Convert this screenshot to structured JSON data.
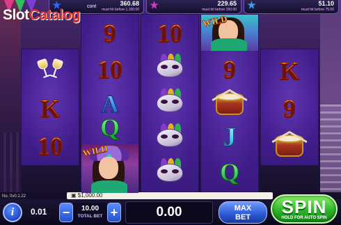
{
  "logo": {
    "part1": "Slot",
    "part2": "Catalog"
  },
  "jackpots": [
    {
      "value": "360.68",
      "must_hit": "must hit before 1,100.00",
      "star_color": "#2a6bff",
      "extra": "cont"
    },
    {
      "value": "229.65",
      "must_hit": "must hit before 250.00",
      "star_color": "#d935c9",
      "extra": ""
    },
    {
      "value": "51.10",
      "must_hit": "must hit before 75.00",
      "star_color": "#3a9ee8",
      "extra": ""
    }
  ],
  "reels": [
    {
      "symbols": [
        "champagne",
        "K",
        "10"
      ]
    },
    {
      "symbols": [
        "9",
        "10",
        "A",
        "Q",
        "wild"
      ]
    },
    {
      "symbols": [
        "10",
        "mask",
        "mask",
        "mask",
        "mask"
      ]
    },
    {
      "symbols": [
        "wild",
        "9",
        "drum",
        "J",
        "Q"
      ]
    },
    {
      "symbols": [
        "K",
        "9",
        "drum"
      ]
    }
  ],
  "wild_text": "WILD",
  "balance": "$1,000.00",
  "build_info": "No. 0v0.1.22",
  "bet_line": "0.01",
  "total_bet": {
    "value": "10.00",
    "label": "TOTAL BET"
  },
  "win": "0.00",
  "buttons": {
    "info": "i",
    "minus": "−",
    "plus": "+",
    "max_bet_line1": "MAX",
    "max_bet_line2": "BET",
    "spin": "SPIN",
    "spin_sub": "HOLD FOR AUTO SPIN"
  },
  "colors": {
    "reel_bg": "#3e1c87",
    "spin": "#2fb52a",
    "blue_button": "#2450c9"
  }
}
